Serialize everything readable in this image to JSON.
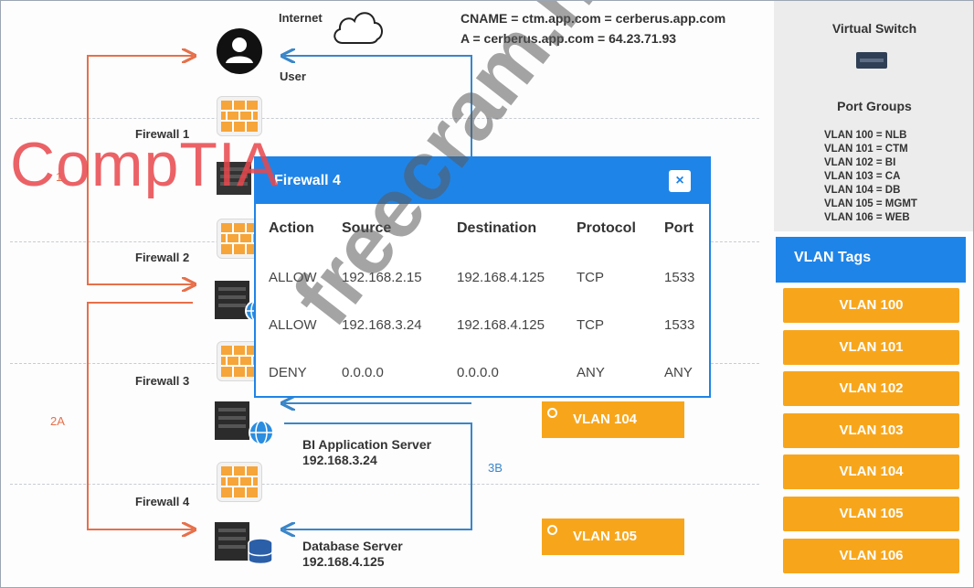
{
  "diagram": {
    "internet_label": "Internet",
    "user_label": "User",
    "dns_line1": "CNAME = ctm.app.com = cerberus.app.com",
    "dns_line2": "A = cerberus.app.com = 64.23.71.93",
    "firewalls": [
      "Firewall 1",
      "Firewall 2",
      "Firewall 3",
      "Firewall 4"
    ],
    "bi_server_name": "BI Application Server",
    "bi_server_ip": "192.168.3.24",
    "db_server_name": "Database Server",
    "db_server_ip": "192.168.4.125",
    "path_label_2a": "2A",
    "path_label_3b": "3B",
    "path_label_1": "1",
    "flow_color_red": "#e6704a",
    "flow_color_blue": "#3a86c8"
  },
  "dropped_vlans": [
    "VLAN 104",
    "VLAN 105"
  ],
  "virtual_switch": {
    "title": "Virtual Switch",
    "port_groups_title": "Port Groups",
    "port_groups": [
      "VLAN 100 = NLB",
      "VLAN 101 = CTM",
      "VLAN 102 = BI",
      "VLAN 103 = CA",
      "VLAN 104 = DB",
      "VLAN 105 = MGMT",
      "VLAN 106 = WEB"
    ]
  },
  "vlan_tags": {
    "title": "VLAN Tags",
    "items": [
      "VLAN 100",
      "VLAN 101",
      "VLAN 102",
      "VLAN 103",
      "VLAN 104",
      "VLAN 105",
      "VLAN 106"
    ],
    "color": "#f7a61c"
  },
  "modal": {
    "title": "Firewall 4",
    "close_label": "×",
    "columns": [
      "Action",
      "Source",
      "Destination",
      "Protocol",
      "Port"
    ],
    "rows": [
      [
        "ALLOW",
        "192.168.2.15",
        "192.168.4.125",
        "TCP",
        "1533"
      ],
      [
        "ALLOW",
        "192.168.3.24",
        "192.168.4.125",
        "TCP",
        "1533"
      ],
      [
        "DENY",
        "0.0.0.0",
        "0.0.0.0",
        "ANY",
        "ANY"
      ]
    ],
    "accent": "#1f84e7"
  },
  "watermarks": {
    "comptia": "CompTIA",
    "freecram": "freecram.net"
  },
  "icons": [
    "cloud-icon",
    "user-icon",
    "firewall-icon",
    "server-icon",
    "globe-icon",
    "database-icon",
    "switch-icon",
    "close-icon"
  ]
}
